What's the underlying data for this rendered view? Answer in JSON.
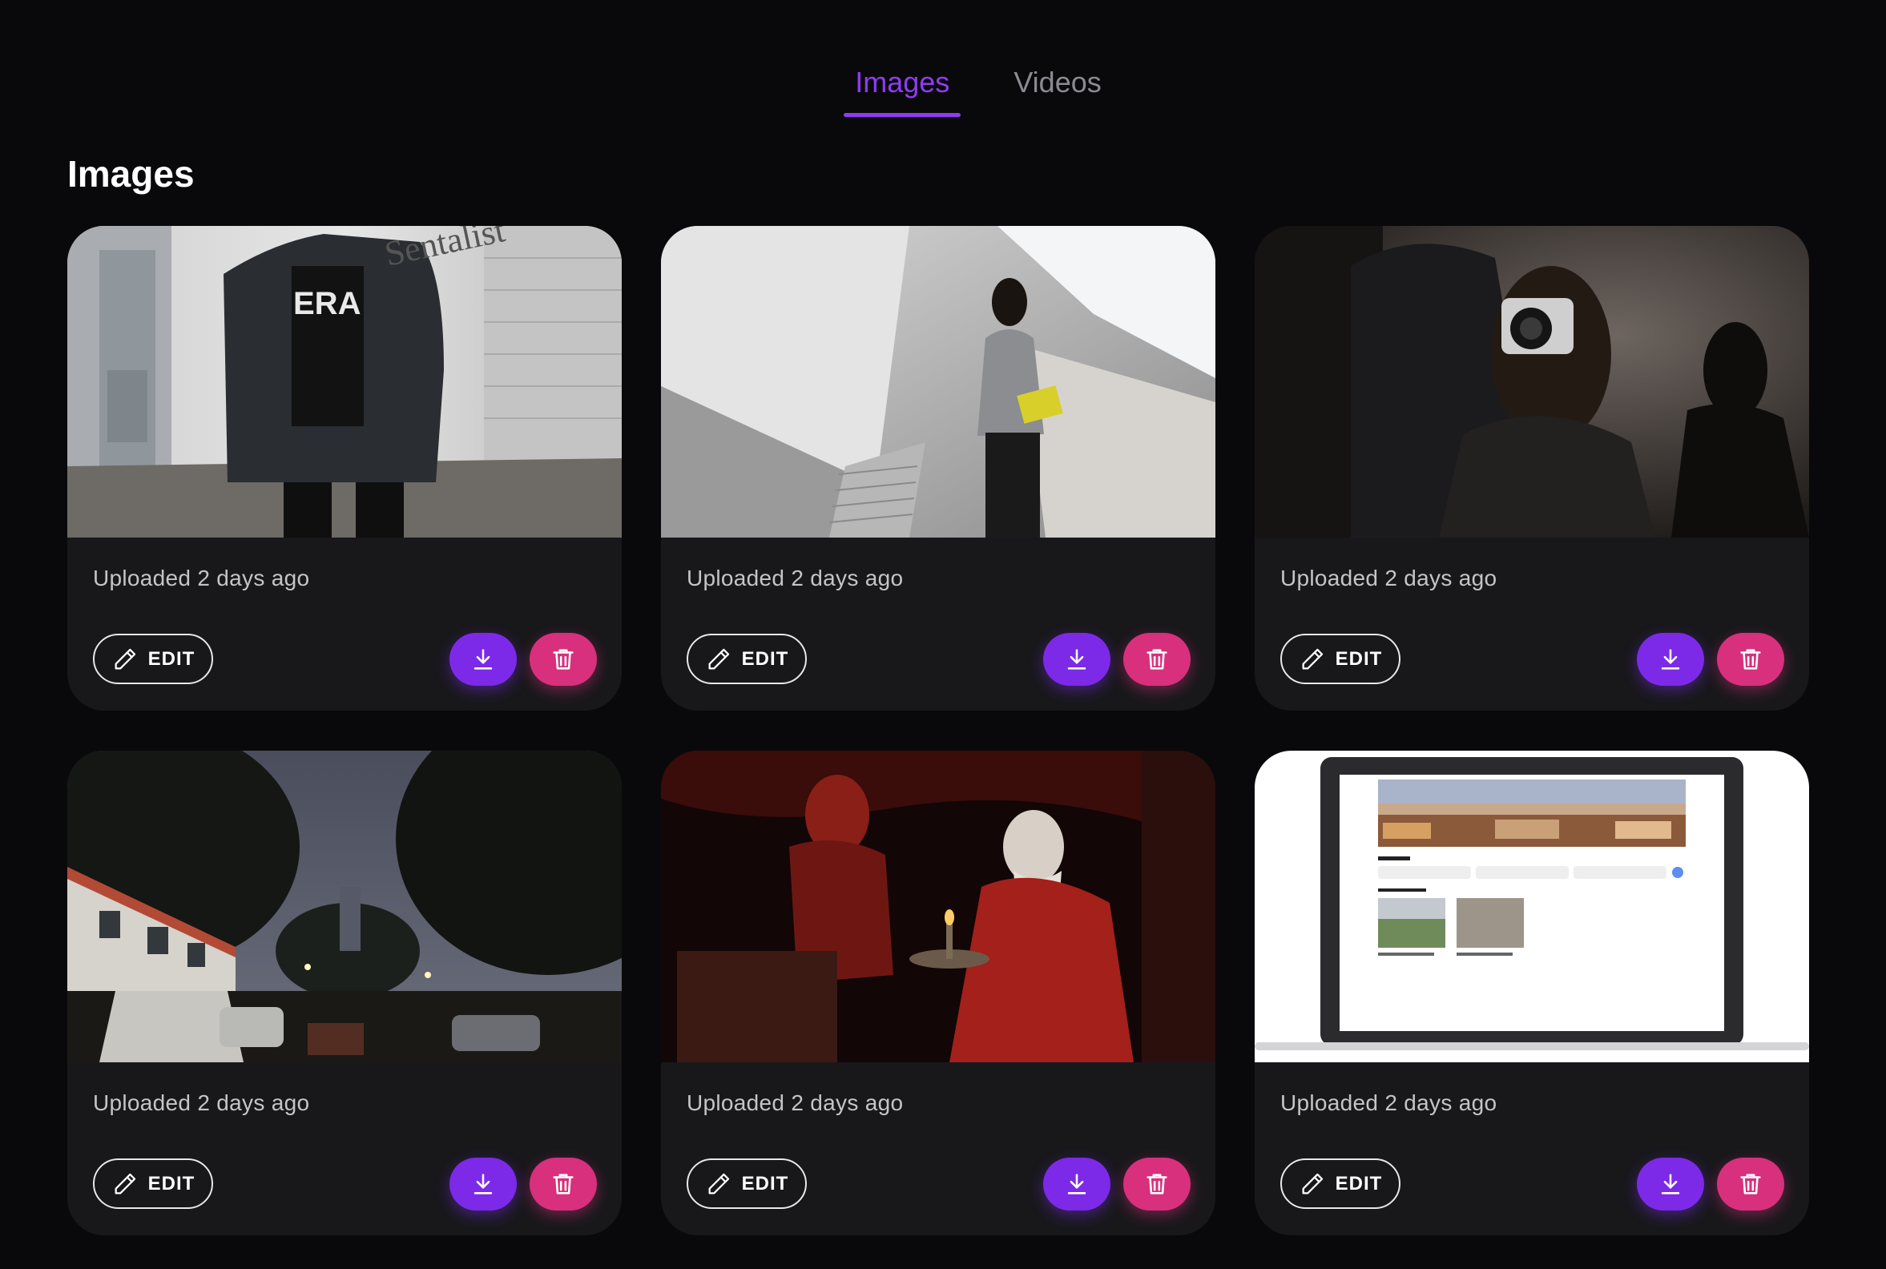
{
  "tabs": [
    {
      "label": "Images",
      "active": true
    },
    {
      "label": "Videos",
      "active": false
    }
  ],
  "section_title": "Images",
  "colors": {
    "accent": "#8f3cf2",
    "download": "#7c2ae8",
    "delete": "#d8307d",
    "card_bg": "#18181b",
    "page_bg": "#09090b"
  },
  "cards": [
    {
      "image": "man-denim-jacket-brick-alley",
      "uploaded": "Uploaded 2 days ago",
      "edit_label": "EDIT"
    },
    {
      "image": "woman-escalator-yellow-book",
      "uploaded": "Uploaded 2 days ago",
      "edit_label": "EDIT"
    },
    {
      "image": "woman-holding-camera",
      "uploaded": "Uploaded 2 days ago",
      "edit_label": "EDIT"
    },
    {
      "image": "night-street-rain-cars",
      "uploaded": "Uploaded 2 days ago",
      "edit_label": "EDIT"
    },
    {
      "image": "red-painting-old-man-skeleton",
      "uploaded": "Uploaded 2 days ago",
      "edit_label": "EDIT"
    },
    {
      "image": "laptop-travel-website",
      "uploaded": "Uploaded 2 days ago",
      "edit_label": "EDIT"
    }
  ]
}
